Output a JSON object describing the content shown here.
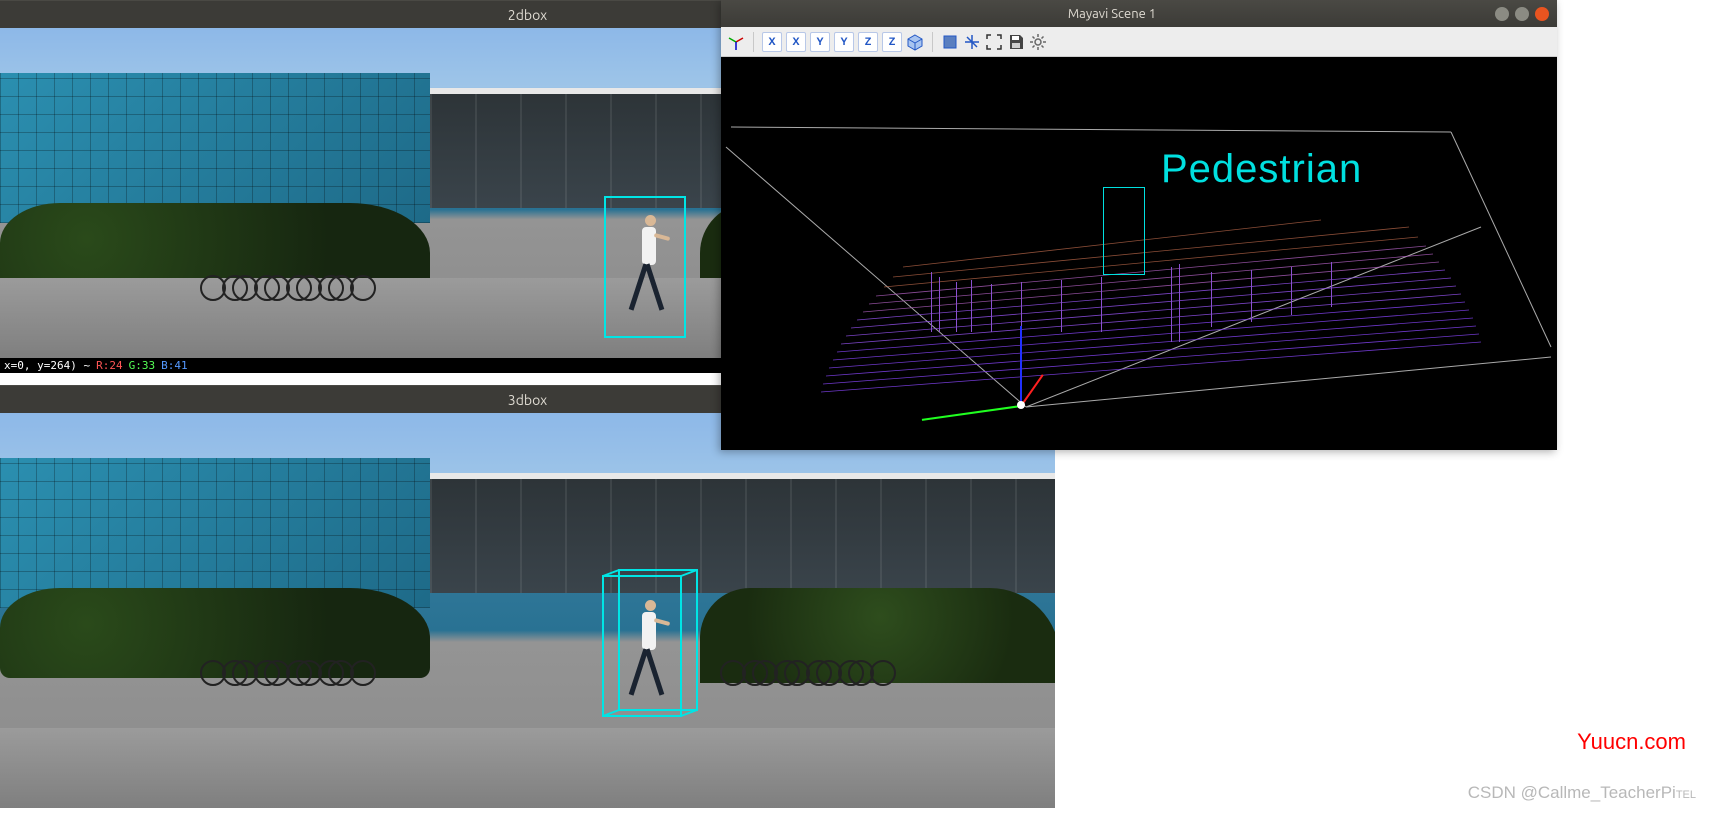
{
  "panes": {
    "top2d": {
      "title": "2dbox"
    },
    "bottom3d": {
      "title": "3dbox"
    }
  },
  "status": {
    "coords": "x=0, y=264) ~ ",
    "r_label": "R:24",
    "g_label": "G:33",
    "b_label": "B:41"
  },
  "detection": {
    "class_label": "Pedestrian"
  },
  "mayavi": {
    "title": "Mayavi Scene 1",
    "toolbar_view_buttons": [
      "X",
      "X",
      "Y",
      "Y",
      "Z",
      "Z"
    ],
    "toolbar_icons": [
      "axes-indicator",
      "isometric",
      "parallel-proj",
      "axis-toggle",
      "fullscreen",
      "save",
      "settings"
    ]
  },
  "watermark": "Yuucn.com",
  "attribution_prefix": "CSDN @Callme_TeacherPi",
  "attribution_suffix": "TEL"
}
